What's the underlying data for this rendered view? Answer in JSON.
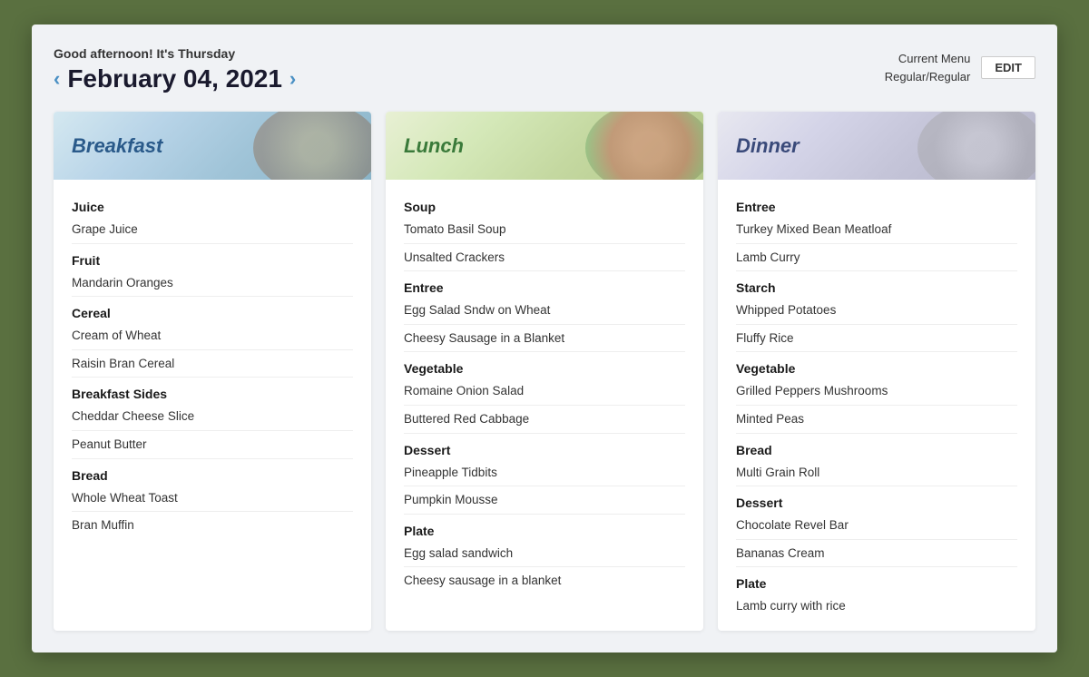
{
  "header": {
    "greeting": "Good afternoon! It's Thursday",
    "date": "February 04, 2021",
    "prev_arrow": "‹",
    "next_arrow": "›",
    "current_menu_label": "Current Menu\nRegular/Regular",
    "edit_button": "EDIT"
  },
  "meals": [
    {
      "id": "breakfast",
      "title": "Breakfast",
      "title_class": "",
      "header_class": "meal-header-breakfast",
      "title_color": "meal-title",
      "sections": [
        {
          "type": "category",
          "label": "Juice"
        },
        {
          "type": "item",
          "label": "Grape Juice"
        },
        {
          "type": "category",
          "label": "Fruit"
        },
        {
          "type": "item",
          "label": "Mandarin Oranges"
        },
        {
          "type": "category",
          "label": "Cereal"
        },
        {
          "type": "item",
          "label": "Cream of Wheat"
        },
        {
          "type": "item",
          "label": "Raisin Bran Cereal"
        },
        {
          "type": "category",
          "label": "Breakfast Sides"
        },
        {
          "type": "item",
          "label": "Cheddar Cheese Slice"
        },
        {
          "type": "item",
          "label": "Peanut Butter"
        },
        {
          "type": "category",
          "label": "Bread"
        },
        {
          "type": "item",
          "label": "Whole Wheat Toast"
        },
        {
          "type": "item",
          "label": "Bran Muffin"
        }
      ]
    },
    {
      "id": "lunch",
      "title": "Lunch",
      "header_class": "meal-header-lunch",
      "title_color": "meal-title meal-title-lunch",
      "sections": [
        {
          "type": "category",
          "label": "Soup"
        },
        {
          "type": "item",
          "label": "Tomato Basil Soup"
        },
        {
          "type": "item",
          "label": "Unsalted Crackers"
        },
        {
          "type": "category",
          "label": "Entree"
        },
        {
          "type": "item",
          "label": "Egg Salad Sndw on Wheat"
        },
        {
          "type": "item",
          "label": "Cheesy Sausage in a Blanket"
        },
        {
          "type": "category",
          "label": "Vegetable"
        },
        {
          "type": "item",
          "label": "Romaine Onion Salad"
        },
        {
          "type": "item",
          "label": "Buttered Red Cabbage"
        },
        {
          "type": "category",
          "label": "Dessert"
        },
        {
          "type": "item",
          "label": "Pineapple Tidbits"
        },
        {
          "type": "item",
          "label": "Pumpkin Mousse"
        },
        {
          "type": "category",
          "label": "Plate"
        },
        {
          "type": "item",
          "label": "Egg salad sandwich"
        },
        {
          "type": "item",
          "label": "Cheesy sausage in a blanket"
        }
      ]
    },
    {
      "id": "dinner",
      "title": "Dinner",
      "header_class": "meal-header-dinner",
      "title_color": "meal-title meal-title-dinner",
      "sections": [
        {
          "type": "category",
          "label": "Entree"
        },
        {
          "type": "item",
          "label": "Turkey Mixed Bean Meatloaf"
        },
        {
          "type": "item",
          "label": "Lamb Curry"
        },
        {
          "type": "category",
          "label": "Starch"
        },
        {
          "type": "item",
          "label": "Whipped Potatoes"
        },
        {
          "type": "item",
          "label": "Fluffy Rice"
        },
        {
          "type": "category",
          "label": "Vegetable"
        },
        {
          "type": "item",
          "label": "Grilled Peppers Mushrooms"
        },
        {
          "type": "item",
          "label": "Minted Peas"
        },
        {
          "type": "category",
          "label": "Bread"
        },
        {
          "type": "item",
          "label": "Multi Grain Roll"
        },
        {
          "type": "category",
          "label": "Dessert"
        },
        {
          "type": "item",
          "label": "Chocolate Revel Bar"
        },
        {
          "type": "item",
          "label": "Bananas Cream"
        },
        {
          "type": "category",
          "label": "Plate"
        },
        {
          "type": "item",
          "label": "Lamb curry with rice"
        }
      ]
    }
  ]
}
